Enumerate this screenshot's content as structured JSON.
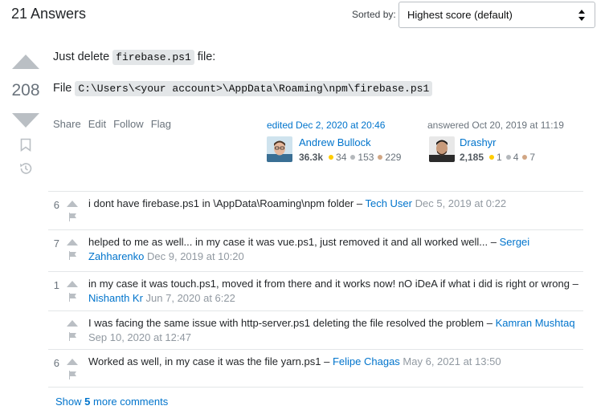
{
  "header": {
    "answers_count": "21 Answers",
    "sort_label": "Sorted by:",
    "sort_value": "Highest score (default)"
  },
  "answer": {
    "score": "208",
    "body": {
      "line1_prefix": "Just delete",
      "line1_code": "firebase.ps1",
      "line1_suffix": "file:",
      "line2_prefix": "File",
      "line2_code": "C:\\Users\\<your account>\\AppData\\Roaming\\npm\\firebase.ps1"
    },
    "menu": [
      "Share",
      "Edit",
      "Follow",
      "Flag"
    ],
    "editor": {
      "action": "edited Dec 2, 2020 at 20:46",
      "name": "Andrew Bullock",
      "reputation": "36.3k",
      "gold": "34",
      "silver": "153",
      "bronze": "229"
    },
    "author": {
      "action": "answered Oct 20, 2019 at 11:19",
      "name": "Drashyr",
      "reputation": "2,185",
      "gold": "1",
      "silver": "4",
      "bronze": "7"
    }
  },
  "comments": [
    {
      "score": "6",
      "text": "i dont have firebase.ps1 in \\AppData\\Roaming\\npm folder",
      "sep": " – ",
      "user": "Tech User",
      "date": "Dec 5, 2019 at 0:22"
    },
    {
      "score": "7",
      "text": "helped to me as well... in my case it was vue.ps1, just removed it and all worked well...",
      "sep": " – ",
      "user": "Sergei Zahharenko",
      "date": "Dec 9, 2019 at 10:20"
    },
    {
      "score": "1",
      "text": "in my case it was touch.ps1, moved it from there and it works now! nO iDeA if what i did is right or wrong",
      "sep": " – ",
      "user": "Nishanth Kr",
      "date": "Jun 7, 2020 at 6:22"
    },
    {
      "score": "",
      "text": "I was facing the same issue with http-server.ps1 deleting the file resolved the problem",
      "sep": " – ",
      "user": "Kamran Mushtaq",
      "date": "Sep 10, 2020 at 12:47"
    },
    {
      "score": "6",
      "text": "Worked as well, in my case it was the file yarn.ps1",
      "sep": " – ",
      "user": "Felipe Chagas",
      "date": "May 6, 2021 at 13:50"
    }
  ],
  "show_more": {
    "prefix": "Show",
    "count": "5",
    "suffix": "more comments"
  },
  "icons": {
    "vote_up": "vote-up-arrow-icon",
    "vote_down": "vote-down-arrow-icon",
    "bookmark": "bookmark-icon",
    "history": "history-icon",
    "comment_upvote": "comment-upvote-icon",
    "comment_flag": "flag-icon",
    "sort_arrows": "sort-arrows-icon"
  },
  "colors": {
    "link": "#0074cc",
    "muted": "#6a737c",
    "vote_arrow": "#babfc4",
    "gold": "#ffcc01",
    "silver": "#b4b8bc",
    "bronze": "#d1a684"
  }
}
